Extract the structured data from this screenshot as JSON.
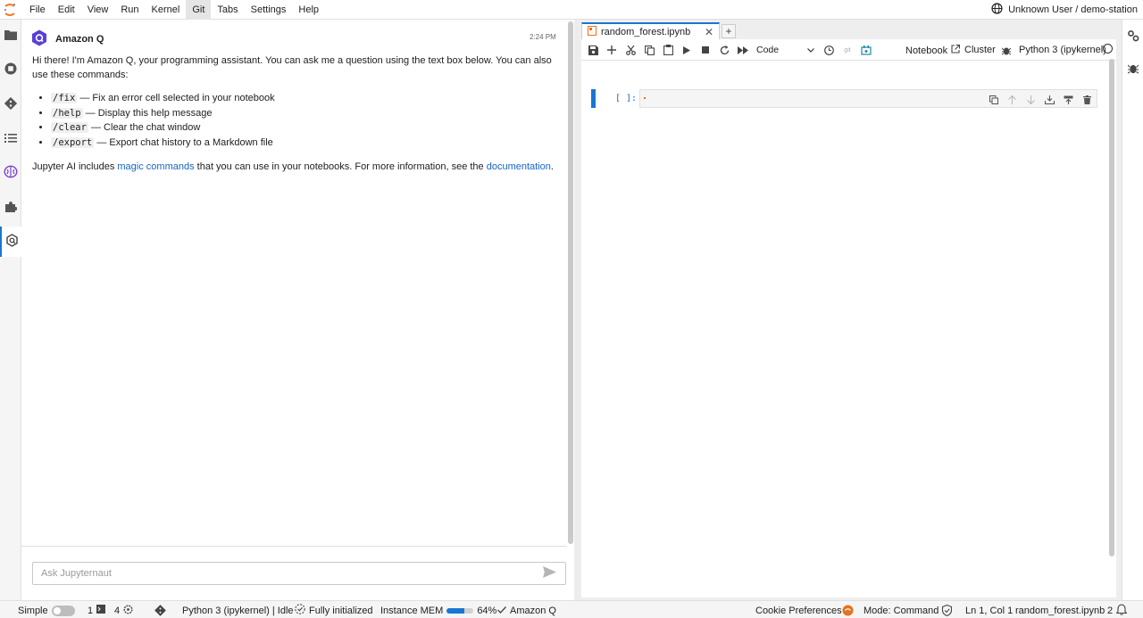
{
  "menubar": {
    "items": [
      "File",
      "Edit",
      "View",
      "Run",
      "Kernel",
      "Git",
      "Tabs",
      "Settings",
      "Help"
    ],
    "active": "Git",
    "user": "Unknown User / demo-station"
  },
  "chat": {
    "assistant_name": "Amazon Q",
    "time": "2:24 PM",
    "intro": "Hi there! I'm Amazon Q, your programming assistant. You can ask me a question using the text box below. You can also use these commands:",
    "commands": [
      {
        "cmd": "/fix",
        "desc": "— Fix an error cell selected in your notebook"
      },
      {
        "cmd": "/help",
        "desc": "— Display this help message"
      },
      {
        "cmd": "/clear",
        "desc": "— Clear the chat window"
      },
      {
        "cmd": "/export",
        "desc": "— Export chat history to a Markdown file"
      }
    ],
    "footer": {
      "pre": "Jupyter AI includes ",
      "link1": "magic commands",
      "mid": " that you can use in your notebooks. For more information, see the ",
      "link2": "documentation",
      "post": "."
    },
    "input_placeholder": "Ask Jupyternaut"
  },
  "notebook": {
    "tab_title": "random_forest.ipynb",
    "add_tab": "+",
    "close_tab": "✕",
    "cell_type": "Code",
    "notebook_label": "Notebook",
    "cluster_label": "Cluster",
    "kernel_label": "Python 3 (ipykernel)",
    "git_label": "git",
    "cell_prompt": "[ ]:"
  },
  "statusbar": {
    "simple_label": "Simple",
    "terminals_count": "1",
    "kernels_count": "4",
    "kernel_status": "Python 3 (ipykernel) | Idle",
    "init_status": "Fully initialized",
    "mem_label": "Instance MEM",
    "mem_percent": "64%",
    "mem_fraction": 0.64,
    "amazonq_label": "Amazon Q",
    "cookie_label": "Cookie Preferences",
    "mode": "Mode: Command",
    "position": "Ln 1, Col 1",
    "filename": "random_forest.ipynb",
    "notif_count": "2"
  },
  "colors": {
    "accent": "#1976d2",
    "link": "#1565c0",
    "amazonq_purple": "#5a3fd6"
  }
}
